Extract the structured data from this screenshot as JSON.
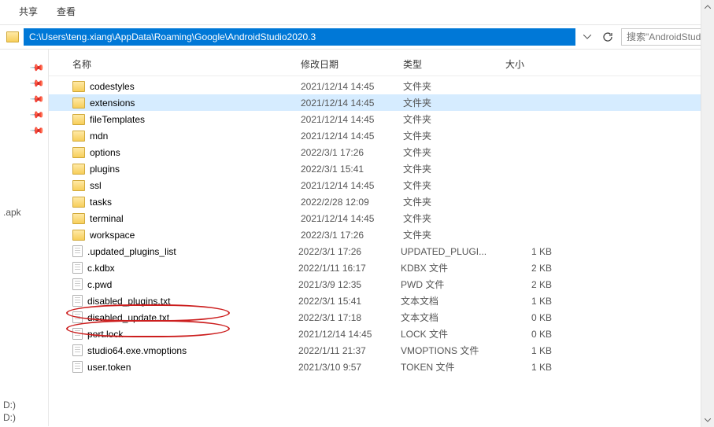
{
  "toolbar": {
    "share": "共享",
    "view": "查看"
  },
  "address": {
    "path": "C:\\Users\\teng.xiang\\AppData\\Roaming\\Google\\AndroidStudio2020.3",
    "search_placeholder": "搜索\"AndroidStudio"
  },
  "columns": {
    "name": "名称",
    "date": "修改日期",
    "type": "类型",
    "size": "大小"
  },
  "rows": [
    {
      "icon": "folder",
      "name": "codestyles",
      "date": "2021/12/14 14:45",
      "type": "文件夹",
      "size": ""
    },
    {
      "icon": "folder",
      "name": "extensions",
      "date": "2021/12/14 14:45",
      "type": "文件夹",
      "size": "",
      "selected": true
    },
    {
      "icon": "folder",
      "name": "fileTemplates",
      "date": "2021/12/14 14:45",
      "type": "文件夹",
      "size": ""
    },
    {
      "icon": "folder",
      "name": "mdn",
      "date": "2021/12/14 14:45",
      "type": "文件夹",
      "size": ""
    },
    {
      "icon": "folder",
      "name": "options",
      "date": "2022/3/1 17:26",
      "type": "文件夹",
      "size": ""
    },
    {
      "icon": "folder",
      "name": "plugins",
      "date": "2022/3/1 15:41",
      "type": "文件夹",
      "size": ""
    },
    {
      "icon": "folder",
      "name": "ssl",
      "date": "2021/12/14 14:45",
      "type": "文件夹",
      "size": ""
    },
    {
      "icon": "folder",
      "name": "tasks",
      "date": "2022/2/28 12:09",
      "type": "文件夹",
      "size": ""
    },
    {
      "icon": "folder",
      "name": "terminal",
      "date": "2021/12/14 14:45",
      "type": "文件夹",
      "size": ""
    },
    {
      "icon": "folder",
      "name": "workspace",
      "date": "2022/3/1 17:26",
      "type": "文件夹",
      "size": ""
    },
    {
      "icon": "file",
      "name": ".updated_plugins_list",
      "date": "2022/3/1 17:26",
      "type": "UPDATED_PLUGI...",
      "size": "1 KB"
    },
    {
      "icon": "file",
      "name": "c.kdbx",
      "date": "2022/1/11 16:17",
      "type": "KDBX 文件",
      "size": "2 KB"
    },
    {
      "icon": "file",
      "name": "c.pwd",
      "date": "2021/3/9 12:35",
      "type": "PWD 文件",
      "size": "2 KB"
    },
    {
      "icon": "file",
      "name": "disabled_plugins.txt",
      "date": "2022/3/1 15:41",
      "type": "文本文档",
      "size": "1 KB"
    },
    {
      "icon": "file",
      "name": "disabled_update.txt",
      "date": "2022/3/1 17:18",
      "type": "文本文档",
      "size": "0 KB"
    },
    {
      "icon": "file",
      "name": "port.lock",
      "date": "2021/12/14 14:45",
      "type": "LOCK 文件",
      "size": "0 KB"
    },
    {
      "icon": "file",
      "name": "studio64.exe.vmoptions",
      "date": "2022/1/11 21:37",
      "type": "VMOPTIONS 文件",
      "size": "1 KB"
    },
    {
      "icon": "file",
      "name": "user.token",
      "date": "2021/3/10 9:57",
      "type": "TOKEN 文件",
      "size": "1 KB"
    }
  ],
  "sidebar": {
    "ext": ".apk",
    "drive1": "D:)",
    "drive2": "D:)"
  }
}
